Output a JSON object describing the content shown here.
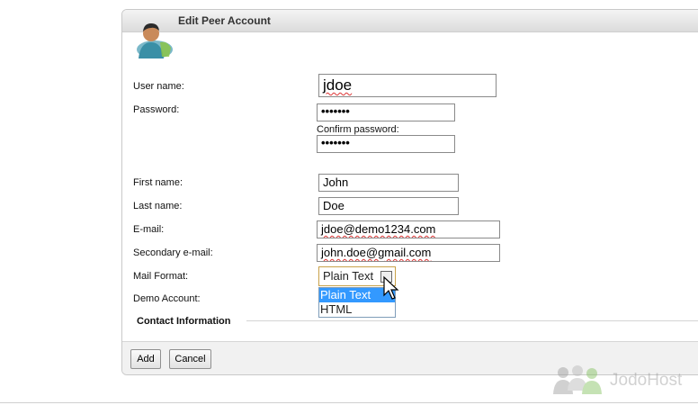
{
  "window": {
    "title": "Edit Peer Account"
  },
  "form": {
    "username_label": "User name:",
    "username_value": "jdoe",
    "password_label": "Password:",
    "password_value": "•••••••",
    "confirm_label": "Confirm password:",
    "confirm_value": "•••••••",
    "firstname_label": "First name:",
    "firstname_value": "John",
    "lastname_label": "Last name:",
    "lastname_value": "Doe",
    "email_label": "E-mail:",
    "email_value": "jdoe@demo1234.com",
    "email2_label": "Secondary e-mail:",
    "email2_value": "john.doe@gmail.com",
    "mailformat_label": "Mail Format:",
    "mailformat_value": "Plain Text",
    "mailformat_options": [
      "Plain Text",
      "HTML"
    ],
    "demo_label": "Demo Account:",
    "contact_section": "Contact Information"
  },
  "footer": {
    "add_label": "Add",
    "cancel_label": "Cancel"
  },
  "watermark": {
    "text": "JodoHost"
  },
  "colors": {
    "selected_option": "#3399ff",
    "select_border": "#c9a24a"
  }
}
